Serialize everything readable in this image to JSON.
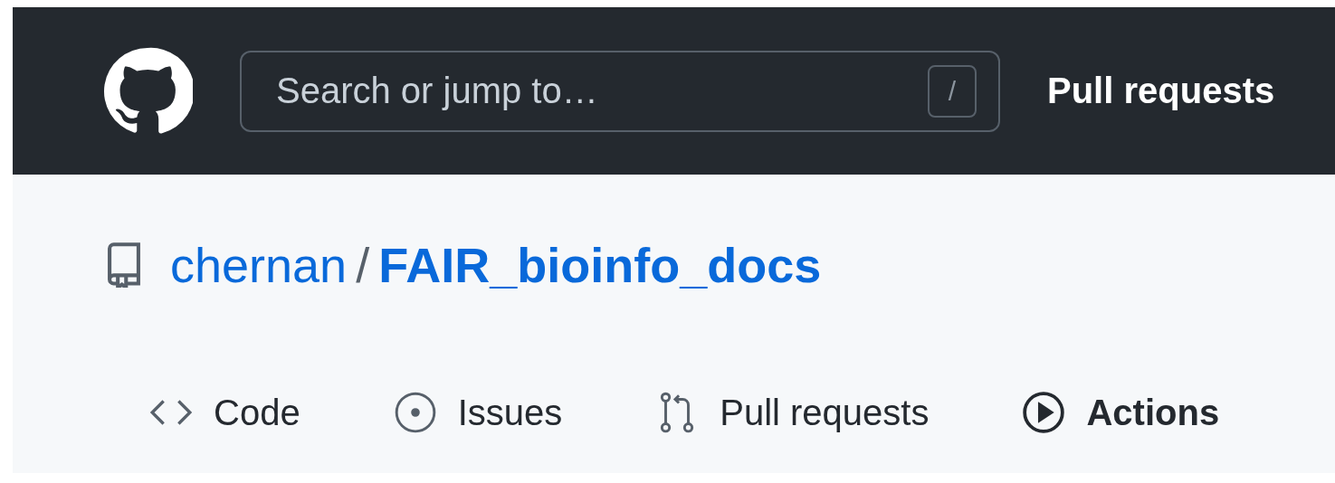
{
  "header": {
    "search": {
      "placeholder": "Search or jump to…",
      "shortcut": "/"
    },
    "nav": [
      "Pull requests"
    ]
  },
  "repo": {
    "owner": "chernan",
    "separator": "/",
    "name": "FAIR_bioinfo_docs"
  },
  "tabs": [
    {
      "label": "Code",
      "kind": "code",
      "selected": false
    },
    {
      "label": "Issues",
      "kind": "issues",
      "selected": false
    },
    {
      "label": "Pull requests",
      "kind": "pull",
      "selected": false
    },
    {
      "label": "Actions",
      "kind": "actions",
      "selected": true
    }
  ]
}
